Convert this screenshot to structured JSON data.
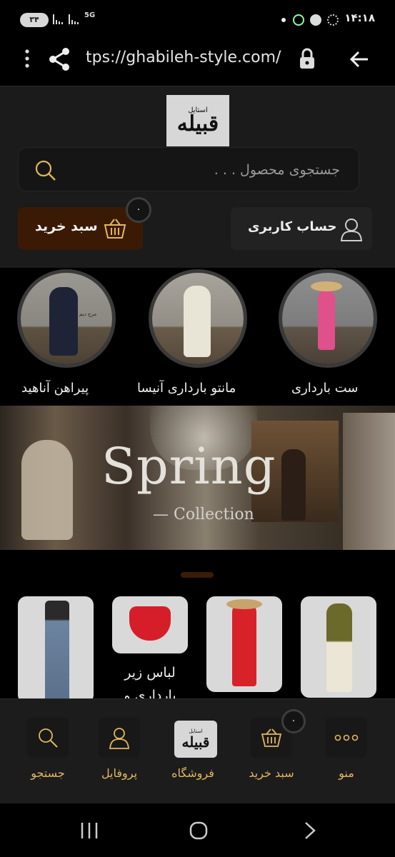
{
  "status_bar": {
    "time": "۱۴:۱۸",
    "battery": "۳۴",
    "network": "5G"
  },
  "browser": {
    "url": "tps://ghabileh-style.com/"
  },
  "header": {
    "logo_text": "قبیله",
    "logo_sub": "استایل",
    "search_placeholder": "جستجوی محصول . . .",
    "cart_label": "سبد خرید",
    "cart_count": "۰",
    "account_label": "حساب کاربری"
  },
  "categories": [
    {
      "label": "ست بارداری"
    },
    {
      "label": "مانتو بارداری آنیسا"
    },
    {
      "label": "پیراهن آناهید"
    }
  ],
  "category_overlay_text": "مرح دیم",
  "banner": {
    "title": "Spring",
    "subtitle": "— Collection"
  },
  "products": [
    {
      "title": ""
    },
    {
      "title": ""
    },
    {
      "title": "لباس زیر بارداری و"
    },
    {
      "title": ""
    }
  ],
  "bottom_nav": {
    "items": [
      {
        "label": "منو",
        "icon": "dots-icon"
      },
      {
        "label": "سبد خرید",
        "icon": "basket-icon",
        "badge": "۰"
      },
      {
        "label": "فروشگاه",
        "icon": "logo-icon"
      },
      {
        "label": "پروفایل",
        "icon": "user-icon"
      },
      {
        "label": "جستجو",
        "icon": "search-icon"
      }
    ]
  },
  "colors": {
    "accent": "#e2b75a",
    "cart_button": "#3b1a05",
    "background": "#000000"
  }
}
